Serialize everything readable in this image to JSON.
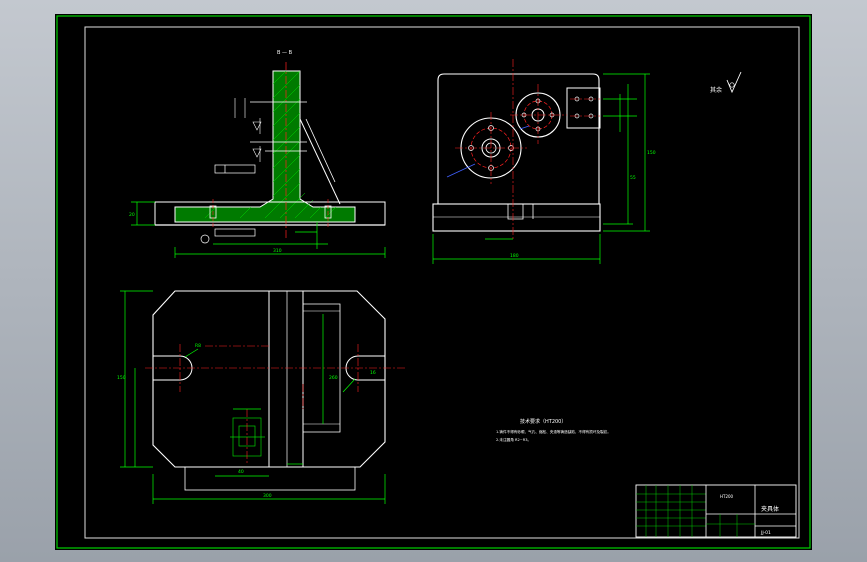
{
  "drawing": {
    "section_label": "B — B",
    "roughness_label": "其余",
    "tech_req_title": "技术要求（HT200）",
    "tech_req_line1": "1.铸件不得有砂眼、气孔、缩松、夹渣等铸造缺陷，不得有损坏及裂纹。",
    "tech_req_line2": "2.未注圆角 R2~R3。",
    "title_block": {
      "part_name": "夹具体",
      "drawing_no": "JJ-01",
      "material": "HT200"
    },
    "dims": {
      "front_width": "310",
      "front_height": "125",
      "front_base": "20",
      "side_width": "180",
      "side_height": "150",
      "side_step": "55",
      "plan_width": "300",
      "plan_depth": "150",
      "plan_inner": "260",
      "plan_slot": "16",
      "plan_r": "R8",
      "plan_bottom": "200",
      "plan_small": "40"
    }
  },
  "colors": {
    "sheet": "#000000",
    "border": "#00d000",
    "line": "#ffffff",
    "dim": "#00ff00",
    "center": "#ff2020",
    "hatch": "#00c000",
    "blue": "#4060ff",
    "cyan": "#00e0e0"
  }
}
